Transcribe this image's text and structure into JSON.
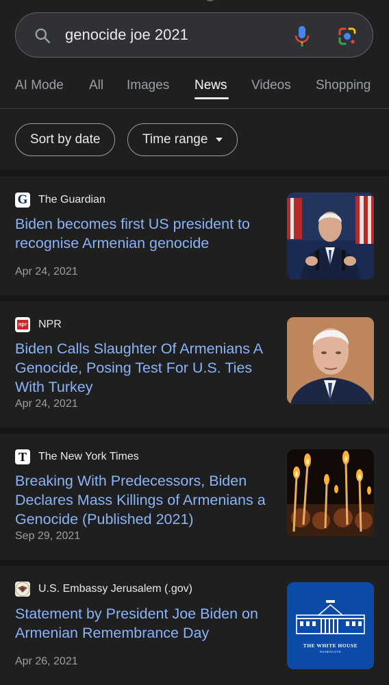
{
  "search": {
    "query": "genocide joe 2021"
  },
  "tabs": [
    {
      "label": "AI Mode"
    },
    {
      "label": "All"
    },
    {
      "label": "Images"
    },
    {
      "label": "News"
    },
    {
      "label": "Videos"
    },
    {
      "label": "Shopping"
    }
  ],
  "active_tab": "News",
  "filters": {
    "sort_label": "Sort by date",
    "time_label": "Time range"
  },
  "results": [
    {
      "source": "The Guardian",
      "headline": "Biden becomes first US president to recognise Armenian genocide",
      "date": "Apr 24, 2021",
      "favicon": "guardian-logo-icon",
      "favicon_text": "G"
    },
    {
      "source": "NPR",
      "headline": "Biden Calls Slaughter Of Armenians A Genocide, Posing Test For U.S. Ties With Turkey",
      "date": "Apr 24, 2021",
      "favicon": "npr-logo-icon",
      "favicon_text": "npr"
    },
    {
      "source": "The New York Times",
      "headline": "Breaking With Predecessors, Biden Declares Mass Killings of Armenians a Genocide (Published 2021)",
      "date": "Sep 29, 2021",
      "favicon": "nyt-logo-icon",
      "favicon_text": "T"
    },
    {
      "source": "U.S. Embassy Jerusalem (.gov)",
      "headline": "Statement by President Joe Biden on Armenian Remembrance Day",
      "date": "Apr 26, 2021",
      "favicon": "us-seal-icon",
      "thumb_text": "THE WHITE HOUSE",
      "thumb_subtext": "WASHINGTON"
    }
  ],
  "colors": {
    "background": "#1f1f1f",
    "link": "#8ab4f8",
    "meta": "#9aa0a6"
  }
}
